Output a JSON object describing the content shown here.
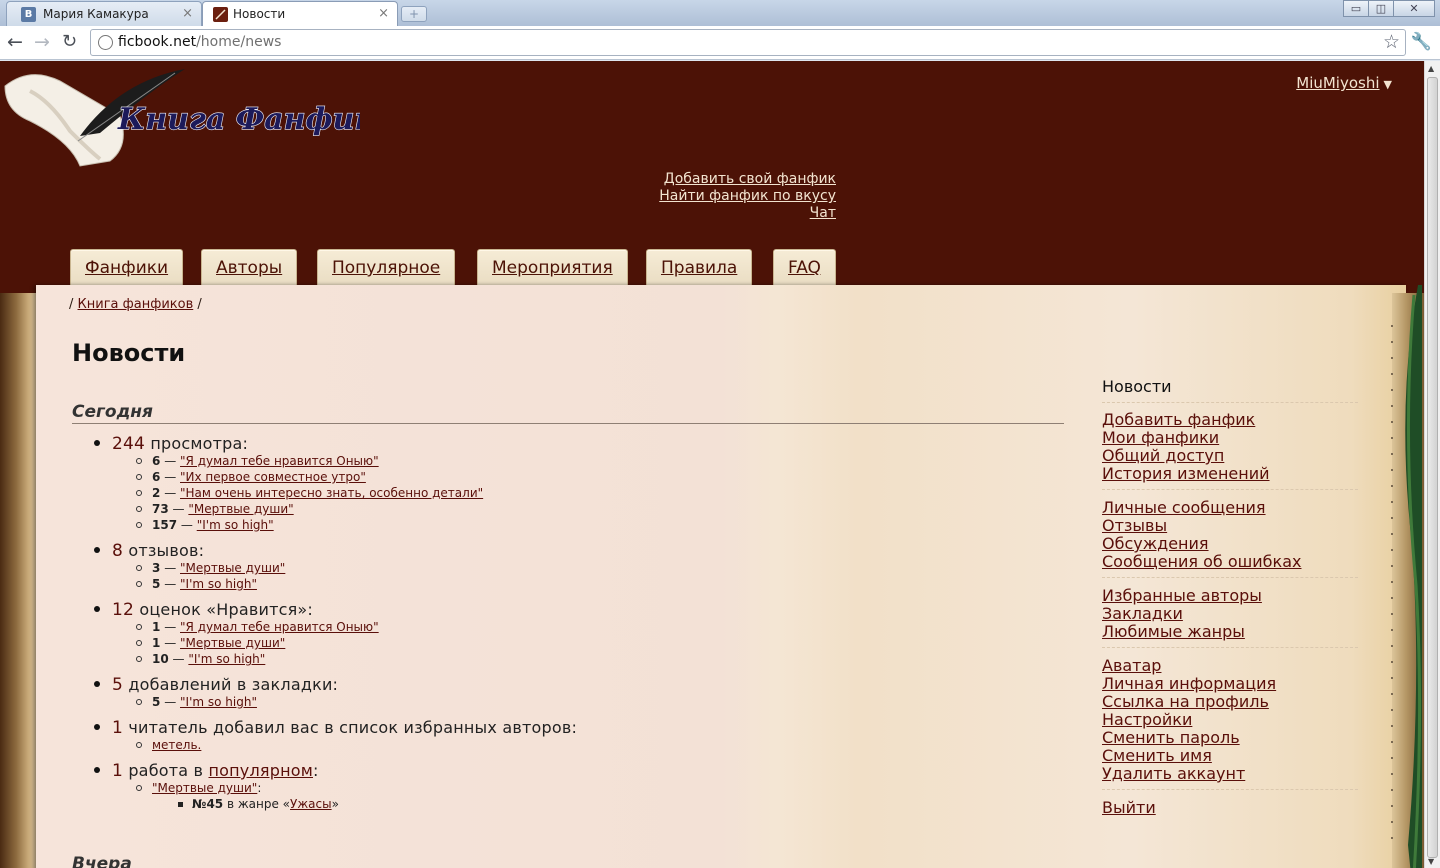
{
  "browser": {
    "tabs": [
      {
        "title": "Мария Камакура",
        "favicon": "В",
        "favicon_color": "#5b7aa5"
      },
      {
        "title": "Новости",
        "favicon": "",
        "favicon_color": "#6b1f0f"
      }
    ],
    "close_glyph": "×",
    "new_tab_glyph": "+",
    "url_host": "ficbook.net",
    "url_path": "/home/news",
    "window_buttons": [
      "▭",
      "◫",
      "✕"
    ]
  },
  "header": {
    "logo_text": "Книга Фанфиков",
    "user": "MiuMiyoshi",
    "user_caret": "▼",
    "top_links": [
      "Добавить свой фанфик",
      "Найти фанфик по вкусу",
      "Чат"
    ]
  },
  "nav": {
    "tabs": [
      "Фанфики",
      "Авторы",
      "Популярное",
      "Мероприятия",
      "Правила",
      "FAQ"
    ]
  },
  "breadcrumb": {
    "sep": "/",
    "home": "Книга фанфиков"
  },
  "page": {
    "title": "Новости",
    "section_today": "Сегодня",
    "section_next": "Вчера",
    "stats": [
      {
        "count": "244",
        "label": "просмотра:",
        "items": [
          {
            "n": "6",
            "title": "\"Я думал тебе нравится Оныю\""
          },
          {
            "n": "6",
            "title": "\"Их первое совместное утро\""
          },
          {
            "n": "2",
            "title": "\"Нам очень интересно знать, особенно детали\""
          },
          {
            "n": "73",
            "title": "\"Мертвые души\""
          },
          {
            "n": "157",
            "title": "\"I'm so high\""
          }
        ]
      },
      {
        "count": "8",
        "label": "отзывов:",
        "items": [
          {
            "n": "3",
            "title": "\"Мертвые души\""
          },
          {
            "n": "5",
            "title": "\"I'm so high\""
          }
        ]
      },
      {
        "count": "12",
        "label": "оценок «Нравится»:",
        "items": [
          {
            "n": "1",
            "title": "\"Я думал тебе нравится Оныю\""
          },
          {
            "n": "1",
            "title": "\"Мертвые души\""
          },
          {
            "n": "10",
            "title": "\"I'm so high\""
          }
        ]
      },
      {
        "count": "5",
        "label": "добавлений в закладки:",
        "items": [
          {
            "n": "5",
            "title": "\"I'm so high\""
          }
        ]
      }
    ],
    "favorite_authors": {
      "count": "1",
      "label": "читатель добавил вас в список избранных авторов:",
      "reader": "метель."
    },
    "popular": {
      "count": "1",
      "label_before": "работа в",
      "link": "популярном",
      "label_after": ":",
      "work": "\"Мертвые души\"",
      "work_suffix": ":",
      "rank": "№45",
      "genre_prefix": "в жанре «",
      "genre": "Ужасы",
      "genre_suffix": "»"
    },
    "dash": "—"
  },
  "sidebar": {
    "title": "Новости",
    "groups": [
      [
        "Добавить фанфик",
        "Мои фанфики",
        "Общий доступ",
        "История изменений"
      ],
      [
        "Личные сообщения",
        "Отзывы",
        "Обсуждения",
        "Сообщения об ошибках"
      ],
      [
        "Избранные авторы",
        "Закладки",
        "Любимые жанры"
      ],
      [
        "Аватар",
        "Личная информация",
        "Ссылка на профиль",
        "Настройки",
        "Сменить пароль",
        "Сменить имя",
        "Удалить аккаунт"
      ],
      [
        "Выйти"
      ]
    ]
  },
  "colors": {
    "header_bg": "#4c1206",
    "link": "#5a0f0a",
    "page_bg": "#f6e4da"
  }
}
